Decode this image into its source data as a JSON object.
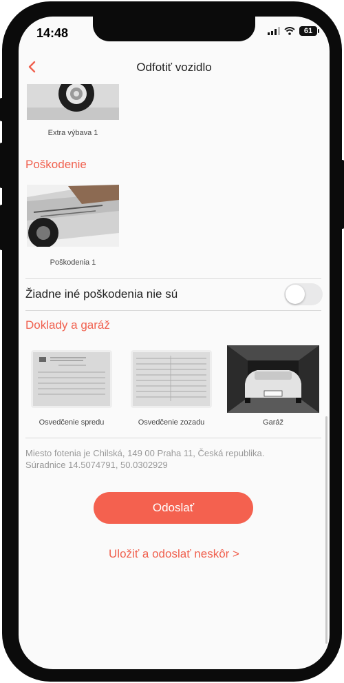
{
  "status_bar": {
    "time": "14:48",
    "battery": "61"
  },
  "nav": {
    "title": "Odfotiť vozidlo",
    "back_icon": "chevron-left-icon"
  },
  "extra": {
    "caption": "Extra výbava 1"
  },
  "damage": {
    "title": "Poškodenie",
    "caption": "Poškodenia 1"
  },
  "no_damage": {
    "label": "Žiadne iné poškodenia nie sú",
    "value": false
  },
  "documents": {
    "title": "Doklady a garáž",
    "items": [
      {
        "caption": "Osvedčenie spredu"
      },
      {
        "caption": "Osvedčenie zozadu"
      },
      {
        "caption": "Garáž"
      }
    ]
  },
  "location": {
    "line1": "Miesto fotenia je  Chilská, 149 00 Praha 11, Česká republika.",
    "line2": "Súradnice 14.5074791, 50.0302929"
  },
  "actions": {
    "submit": "Odoslať",
    "later": "Uložiť a odoslať neskôr >"
  },
  "colors": {
    "accent": "#f0604e",
    "button": "#f4614f"
  }
}
